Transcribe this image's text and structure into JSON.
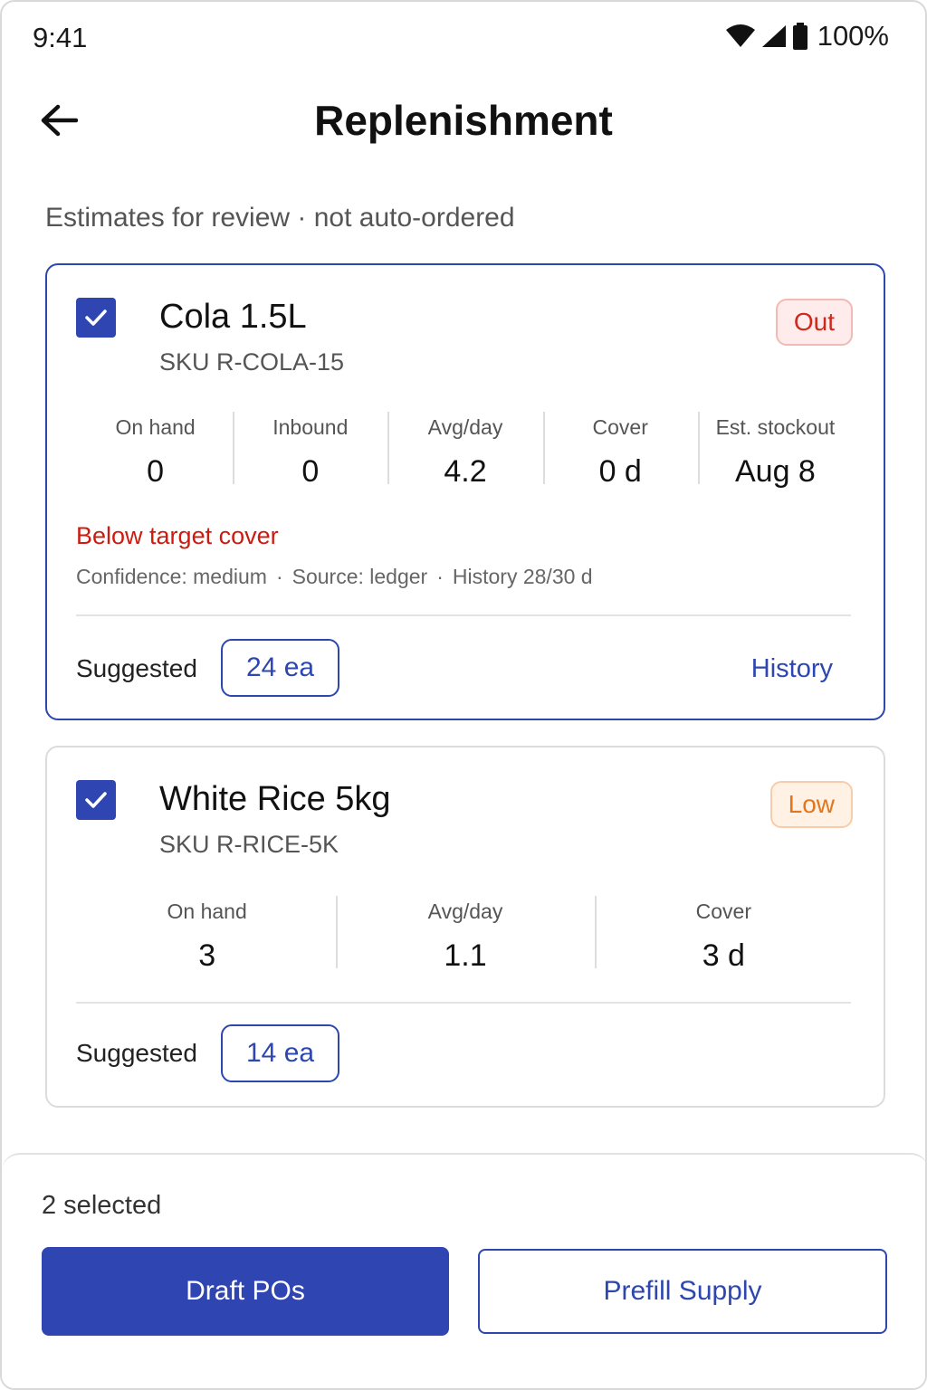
{
  "status_bar": {
    "time": "9:41",
    "battery": "100%",
    "icons": [
      "wifi-icon",
      "signal-icon",
      "battery-icon"
    ]
  },
  "header": {
    "title": "Replenishment",
    "back_icon": "arrow-left-icon"
  },
  "subtitle": "Estimates for review · not auto-ordered",
  "items": [
    {
      "name": "Cola 1.5L",
      "sku": "SKU R-COLA-15",
      "checked": true,
      "badge": "Out",
      "metrics": [
        {
          "label": "On hand",
          "value": "0"
        },
        {
          "label": "Inbound",
          "value": "0"
        },
        {
          "label": "Avg/day",
          "value": "4.2"
        },
        {
          "label": "Cover",
          "value": "0 d"
        },
        {
          "label": "Est. stockout",
          "value": "Aug 8"
        }
      ],
      "warning": "Below target cover",
      "confidence": "Confidence:  medium",
      "source": "Source: ledger",
      "history_days": "History 28/30 d",
      "suggested_label": "Suggested",
      "suggested_qty": "24 ea",
      "history_link": "History"
    },
    {
      "name": "White Rice 5kg",
      "sku": "SKU R-RICE-5K",
      "checked": true,
      "badge": "Low",
      "metrics": [
        {
          "label": "On hand",
          "value": "3"
        },
        {
          "label": "Avg/day",
          "value": "1.1"
        },
        {
          "label": "Cover",
          "value": "3 d"
        }
      ],
      "suggested_label": "Suggested",
      "suggested_qty": "14 ea"
    }
  ],
  "footer": {
    "selected_count": "2 selected",
    "primary_button": "Draft POs",
    "secondary_button": "Prefill Supply"
  },
  "colors": {
    "accent": "#2E45B2",
    "danger": "#CC1C12",
    "warning": "#E2761E"
  }
}
